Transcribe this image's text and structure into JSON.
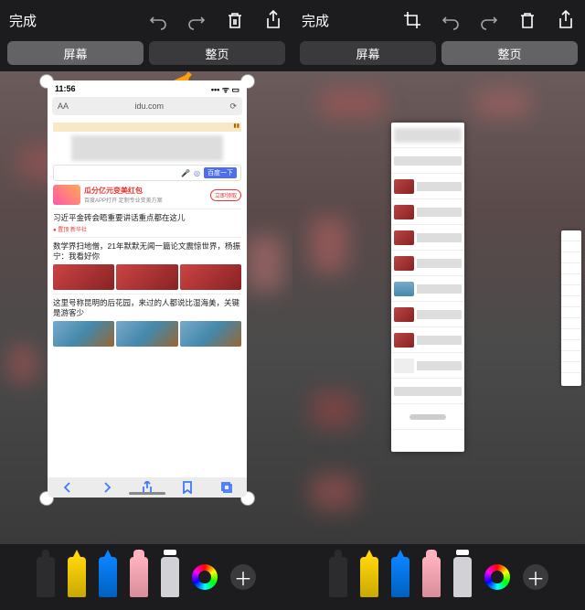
{
  "toolbar": {
    "done": "完成",
    "icons": [
      "undo",
      "redo",
      "crop",
      "trash",
      "share"
    ]
  },
  "segments": {
    "screen": "屏幕",
    "fullpage": "整页"
  },
  "left": {
    "active_segment": "screen",
    "highlight_target": "fullpage",
    "status_time": "11:56",
    "url_text": "idu.com",
    "url_prefix": "AA",
    "search_button": "百度一下",
    "banner_title": "瓜分亿元变美红包",
    "banner_sub": "百度APP打开 定制专业变美方案",
    "get_button": "立即领取",
    "news": [
      {
        "title": "习近平金砖会晤重要讲话重点都在这儿",
        "sub": "● 置顶 新华社"
      },
      {
        "title": "数学界扫地僧，21年默默无闻一篇论文震惊世界，杨振宁：我看好你",
        "sub": ""
      },
      {
        "title": "这里号称昆明的后花园，来过的人都说比湿海美，关键是游客少",
        "sub": ""
      }
    ]
  },
  "right": {
    "active_segment": "fullpage",
    "toolbar_icons": [
      "done",
      "crop",
      "undo",
      "redo",
      "trash",
      "share"
    ]
  },
  "tools": [
    "pen",
    "yellow-marker",
    "blue-marker",
    "pink-pencil",
    "eraser",
    "color-picker",
    "add"
  ]
}
